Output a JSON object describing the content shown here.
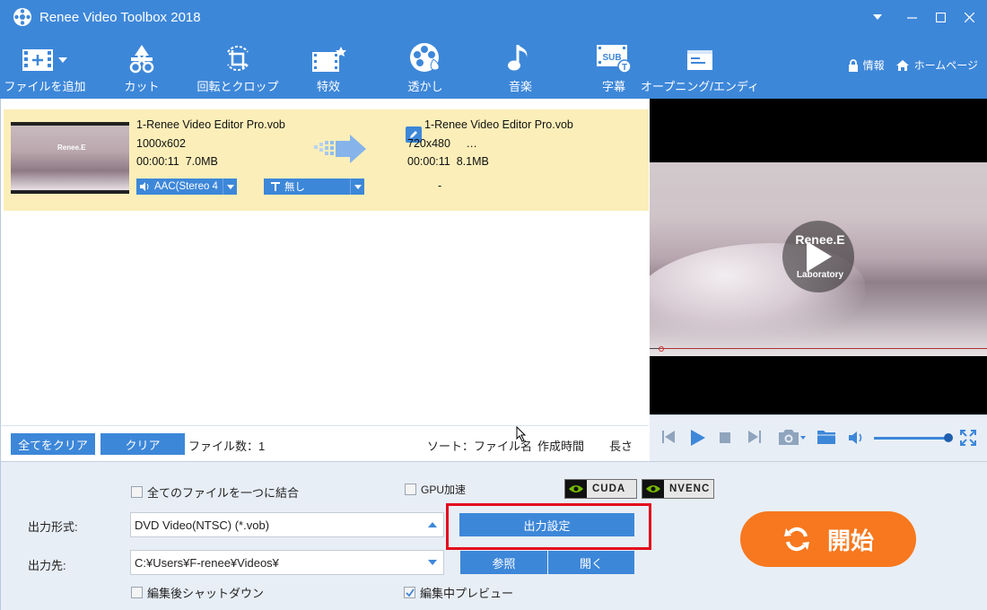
{
  "window": {
    "title": "Renee Video Toolbox 2018",
    "controls": [
      "▼",
      "—",
      "☐",
      "✕"
    ]
  },
  "toolbar": {
    "items": [
      {
        "label": "ファイルを追加",
        "icon": "add-file-icon"
      },
      {
        "label": "カット",
        "icon": "cut-icon"
      },
      {
        "label": "回転とクロップ",
        "icon": "rotate-crop-icon"
      },
      {
        "label": "特效",
        "icon": "effects-icon"
      },
      {
        "label": "透かし",
        "icon": "watermark-icon"
      },
      {
        "label": "音楽",
        "icon": "music-icon"
      },
      {
        "label": "字幕",
        "icon": "subtitle-icon"
      },
      {
        "label": "オープニング/エンディ",
        "icon": "opening-ending-icon"
      }
    ],
    "info_label": "情報",
    "home_label": "ホームページ"
  },
  "file_row": {
    "source": {
      "name": "1-Renee Video Editor Pro.vob",
      "resolution": "1000x602",
      "duration": "00:00:11",
      "size": "7.0MB"
    },
    "output": {
      "name": "1-Renee Video Editor Pro.vob",
      "resolution": "720x480",
      "extra": "…",
      "duration": "00:00:11",
      "size": "8.1MB"
    },
    "audio_track": "AAC(Stereo 4",
    "subtitle": "無し",
    "subtitle_output": "-",
    "thumb_watermark": "Renee.E"
  },
  "list_footer": {
    "clear_all": "全てをクリア",
    "clear": "クリア",
    "file_count_label": "ファイル数：",
    "file_count": "1",
    "sort_label": "ソート：ファイル名",
    "sort_created": "作成時間",
    "sort_length": "長さ"
  },
  "preview": {
    "watermark_title": "Renee.E",
    "watermark_sub": "Laboratory"
  },
  "settings": {
    "merge_all": "全てのファイルを一つに結合",
    "merge_all_checked": false,
    "gpu_accel": "GPU加速",
    "gpu_accel_checked": false,
    "cuda": "CUDA",
    "nvenc": "NVENC",
    "format_label": "出力形式:",
    "format_value": "DVD Video(NTSC) (*.vob)",
    "output_settings": "出力設定",
    "dest_label": "出力先:",
    "dest_value": "C:¥Users¥F-renee¥Videos¥",
    "browse": "参照",
    "open": "開く",
    "shutdown_after": "編集後シャットダウン",
    "shutdown_checked": false,
    "preview_during": "編集中プレビュー",
    "preview_checked": true,
    "start": "開始"
  },
  "colors": {
    "accent": "#3d87d9",
    "row_highlight": "#fbeeb9",
    "start_orange": "#f7781e",
    "highlight_red": "#e3091d"
  }
}
